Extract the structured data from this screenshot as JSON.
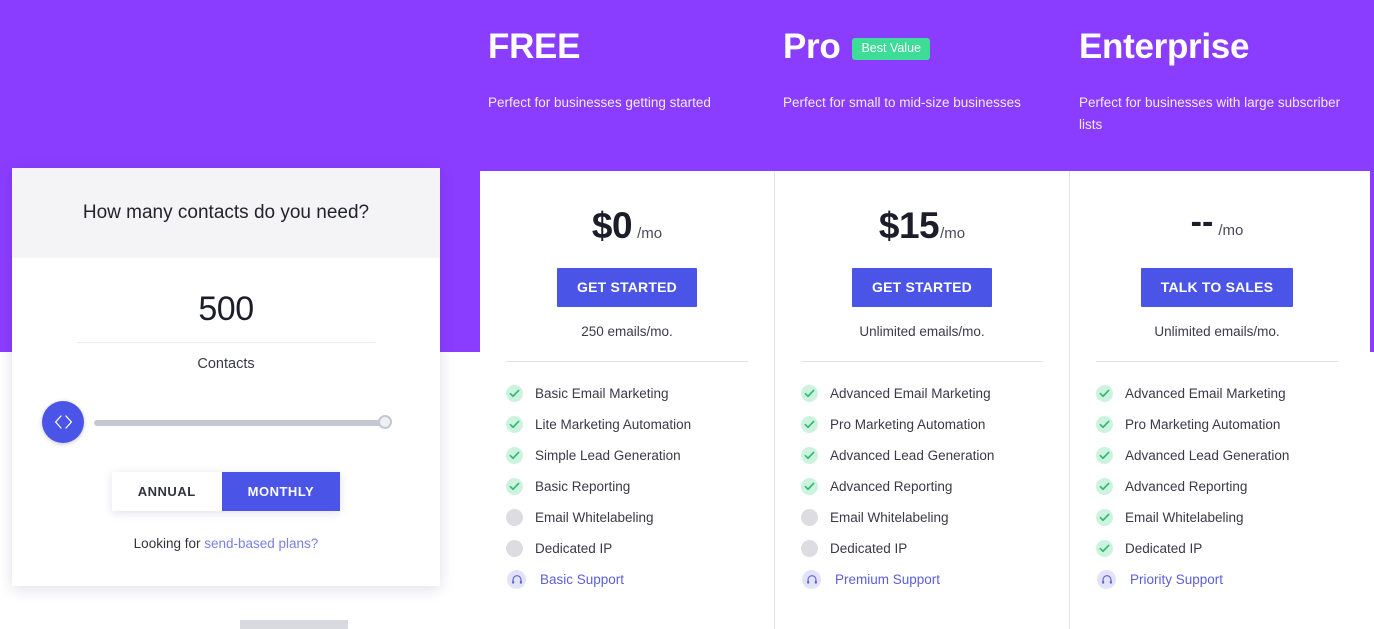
{
  "theme": {
    "hero_purple": "#8b3dff",
    "accent_blue": "#4a55e8",
    "badge_green": "#3ddc97",
    "check_green_bg": "#cdf3de",
    "support_link": "#5b5fd6"
  },
  "calculator": {
    "question": "How many contacts do you need?",
    "count": "500",
    "unit": "Contacts",
    "slider": {
      "handle_icon": "chevron-left-right-icon",
      "value": "500",
      "min_end_icon": "slider-end-knob"
    },
    "billing_toggle": {
      "options": [
        {
          "label": "ANNUAL",
          "active": false
        },
        {
          "label": "MONTHLY",
          "active": true
        }
      ]
    },
    "footer_text": "Looking for ",
    "footer_link": "send-based plans?"
  },
  "plans": [
    {
      "name": "FREE",
      "badge": null,
      "tagline": "Perfect for businesses getting started",
      "price": "$0",
      "period": "/mo",
      "cta": "GET STARTED",
      "emails": "250 emails/mo.",
      "features": [
        {
          "label": "Basic Email Marketing",
          "included": true
        },
        {
          "label": "Lite Marketing Automation",
          "included": true
        },
        {
          "label": "Simple Lead Generation",
          "included": true
        },
        {
          "label": "Basic Reporting",
          "included": true
        },
        {
          "label": "Email Whitelabeling",
          "included": false
        },
        {
          "label": "Dedicated IP",
          "included": false
        }
      ],
      "support": {
        "label": "Basic Support",
        "icon": "headset-icon"
      }
    },
    {
      "name": "Pro",
      "badge": "Best Value",
      "tagline": "Perfect for small to mid-size businesses",
      "price": "$15",
      "period": "/mo",
      "cta": "GET STARTED",
      "emails": "Unlimited emails/mo.",
      "features": [
        {
          "label": "Advanced Email Marketing",
          "included": true
        },
        {
          "label": "Pro Marketing Automation",
          "included": true
        },
        {
          "label": "Advanced Lead Generation",
          "included": true
        },
        {
          "label": "Advanced Reporting",
          "included": true
        },
        {
          "label": "Email Whitelabeling",
          "included": false
        },
        {
          "label": "Dedicated IP",
          "included": false
        }
      ],
      "support": {
        "label": "Premium Support",
        "icon": "headset-icon"
      }
    },
    {
      "name": "Enterprise",
      "badge": null,
      "tagline": "Perfect for businesses with large subscriber lists",
      "price": "--",
      "period": "/mo",
      "cta": "TALK TO SALES",
      "emails": "Unlimited emails/mo.",
      "features": [
        {
          "label": "Advanced Email Marketing",
          "included": true
        },
        {
          "label": "Pro Marketing Automation",
          "included": true
        },
        {
          "label": "Advanced Lead Generation",
          "included": true
        },
        {
          "label": "Advanced Reporting",
          "included": true
        },
        {
          "label": "Email Whitelabeling",
          "included": true
        },
        {
          "label": "Dedicated IP",
          "included": true
        }
      ],
      "support": {
        "label": "Priority Support",
        "icon": "headset-icon"
      }
    }
  ]
}
